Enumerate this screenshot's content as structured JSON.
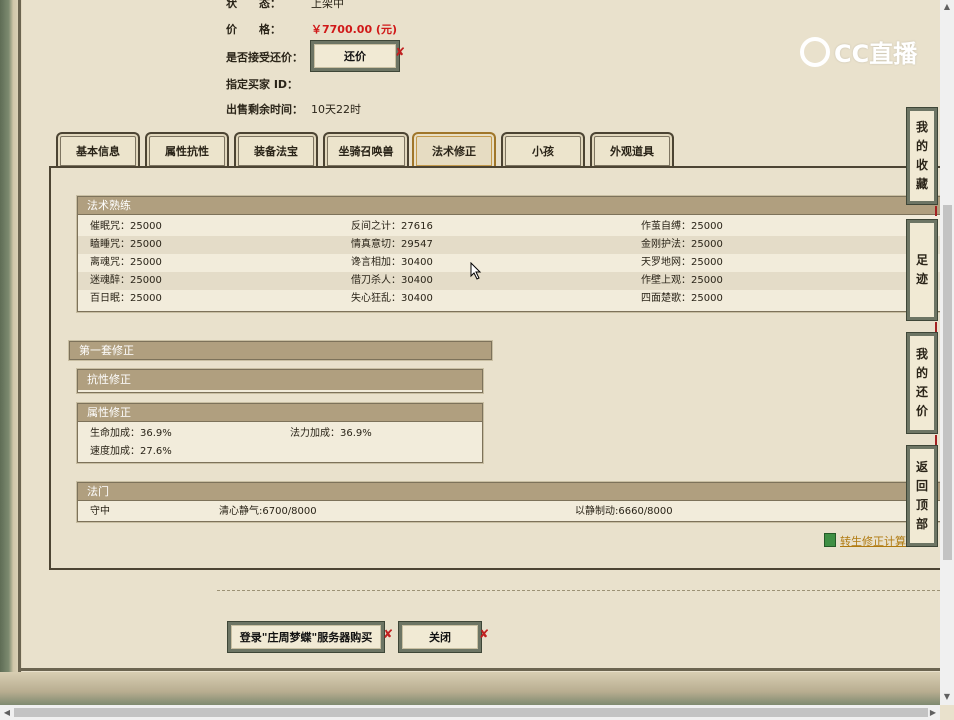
{
  "info": {
    "status_label": "状　　态：",
    "status_value": "上架中",
    "price_label": "价　　格：",
    "price_value": "￥7700.00 (元)",
    "bargain_label": "是否接受还价：",
    "bargain_button": "还价",
    "buyer_label": "指定买家 ID：",
    "remaining_label": "出售剩余时间：",
    "remaining_value": "10天22时"
  },
  "logo": {
    "text": "CC直播"
  },
  "tabs": [
    "基本信息",
    "属性抗性",
    "装备法宝",
    "坐骑召唤兽",
    "法术修正",
    "小孩",
    "外观道具"
  ],
  "active_tab": "法术修正",
  "skill_section": {
    "title": "法术熟练",
    "rows": [
      [
        "催眠咒：25000",
        "反间之计：27616",
        "作茧自缚：25000"
      ],
      [
        "瞌睡咒：25000",
        "情真意切：29547",
        "金刚护法：25000"
      ],
      [
        "离魂咒：25000",
        "谗言相加：30400",
        "天罗地网：25000"
      ],
      [
        "迷魂醉：25000",
        "借刀杀人：30400",
        "作壁上观：25000"
      ],
      [
        "百日眠：25000",
        "失心狂乱：30400",
        "四面楚歌：25000"
      ]
    ]
  },
  "mod_section": {
    "title": "第一套修正",
    "resist_title": "抗性修正",
    "attr_title": "属性修正",
    "attr_rows": [
      [
        "生命加成：36.9%",
        "法力加成：36.9%"
      ],
      [
        "速度加成：27.6%",
        ""
      ]
    ]
  },
  "fameng": {
    "title": "法门",
    "values": [
      "守中",
      "清心静气:6700/8000",
      "以静制动:6660/8000"
    ]
  },
  "calc_link": "转生修正计算",
  "bottom_buttons": {
    "login_buy": "登录\"庄周梦蝶\"服务器购买",
    "close": "关闭"
  },
  "side_nav": [
    {
      "id": "favorites",
      "label": "我的收藏",
      "chars": [
        "我",
        "的",
        "收",
        "藏"
      ]
    },
    {
      "id": "footprint",
      "label": "足迹",
      "chars": [
        "足",
        "迹"
      ]
    },
    {
      "id": "my-bargain",
      "label": "我的还价",
      "chars": [
        "我",
        "的",
        "还",
        "价"
      ]
    },
    {
      "id": "back-top",
      "label": "返回顶部",
      "chars": [
        "返",
        "回",
        "顶",
        "部"
      ]
    }
  ],
  "colors": {
    "price": "#d01818",
    "box_header": "#b09f7f",
    "paper": "#e9e1cc",
    "link": "#b07a10"
  }
}
